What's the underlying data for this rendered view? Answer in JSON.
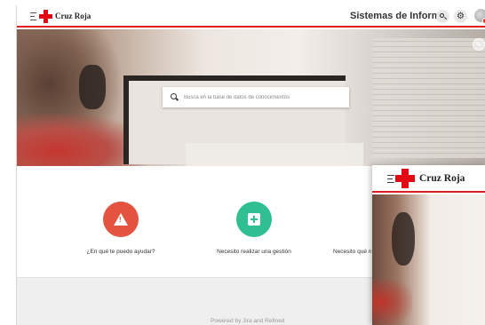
{
  "header": {
    "logo_text": "Cruz Roja",
    "title": "Sistemas de Inform...",
    "search_glyph": "🔍",
    "settings_glyph": "⚙"
  },
  "hero": {
    "search_placeholder": "Busca en la base de datos de conocimientos"
  },
  "options": [
    {
      "label": "¿En qué te puedo ayudar?",
      "color": "#e4533f",
      "icon": "warning-icon"
    },
    {
      "label": "Necesito realizar una gestión",
      "color": "#2fbf91",
      "icon": "plus-square-icon"
    },
    {
      "label": "Necesito qué n",
      "color": "",
      "icon": ""
    }
  ],
  "footer": {
    "text": "Powered by Jira and Refined"
  },
  "overlay": {
    "logo_text": "Cruz Roja"
  }
}
